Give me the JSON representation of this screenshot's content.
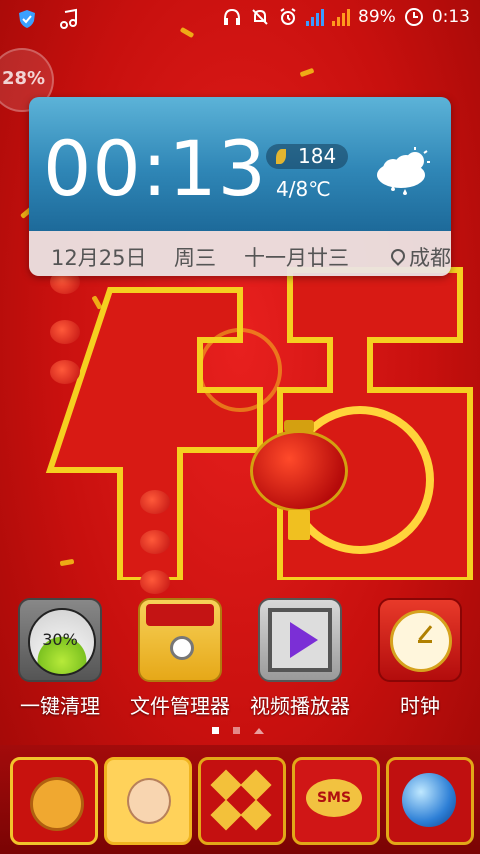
{
  "status_bar": {
    "battery_text": "89%",
    "time": "0:13",
    "left_icons": [
      "shield-badge-icon",
      "music-note-icon"
    ],
    "right_icons": [
      "headset-icon",
      "mute-bell-icon",
      "alarm-icon",
      "wifi-signal-icon",
      "cell-signal-icon",
      "battery-icon"
    ]
  },
  "memory_indicator": {
    "percent": "28%"
  },
  "weather_widget": {
    "clock": "00:13",
    "aqi": "184",
    "temperature": "4/8℃",
    "weather_icon": "cloud-rain-sun-icon",
    "date": "12月25日",
    "weekday": "周三",
    "lunar_date": "十一月廿三",
    "city": "成都"
  },
  "apps": [
    {
      "label": "一键清理",
      "icon": "memory-clean-icon",
      "badge": "30%"
    },
    {
      "label": "文件管理器",
      "icon": "file-manager-icon"
    },
    {
      "label": "视频播放器",
      "icon": "video-player-icon"
    },
    {
      "label": "时钟",
      "icon": "clock-icon"
    }
  ],
  "pager": {
    "pages": 2,
    "active": 0
  },
  "dock": [
    {
      "icon": "phone-dialpad-icon"
    },
    {
      "icon": "contacts-icon"
    },
    {
      "icon": "app-grid-icon"
    },
    {
      "icon": "sms-icon",
      "text": "SMS"
    },
    {
      "icon": "browser-globe-icon"
    }
  ],
  "colors": {
    "wallpaper_red": "#c8100e",
    "accent_gold": "#f5c518",
    "widget_blue": "#2f86b6"
  }
}
